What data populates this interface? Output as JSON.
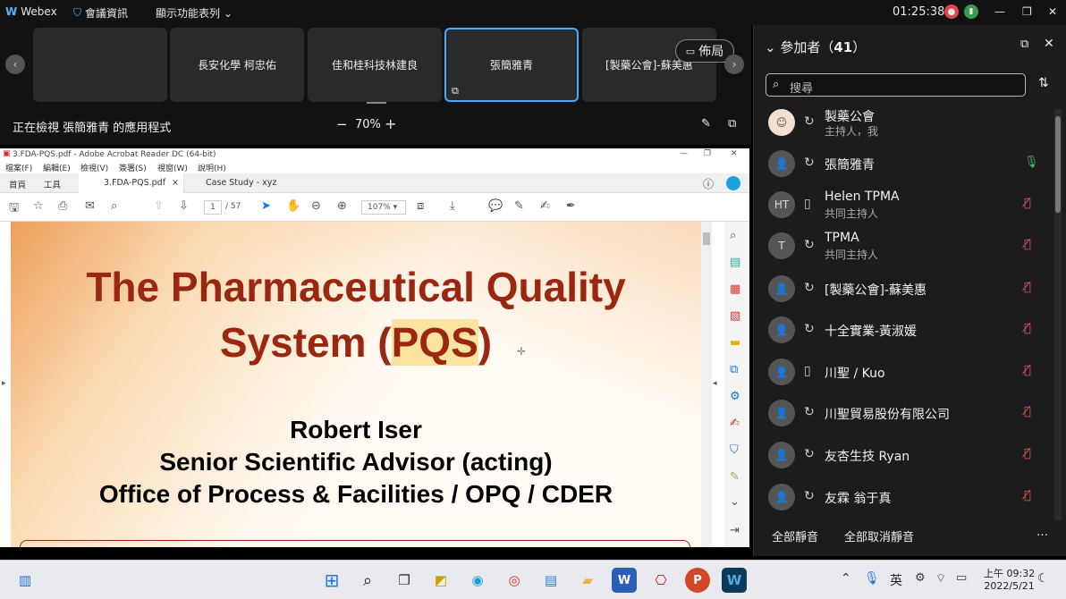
{
  "topbar": {
    "app": "Webex",
    "meeting_info": "會議資訊",
    "display_menu": "顯示功能表列",
    "time": "01:25:38"
  },
  "tiles": [
    "",
    "長安化學 柯忠佑",
    "佳和桂科技林建良",
    "張簡雅青",
    "[製藥公會]-蘇美惠"
  ],
  "layout_label": "佈局",
  "share": {
    "viewing": "正在檢視 張簡雅青 的應用程式",
    "zoom": "70%"
  },
  "pdf": {
    "title": "3.FDA-PQS.pdf - Adobe Acrobat Reader DC (64-bit)",
    "menu": [
      "檔案(F)",
      "編輯(E)",
      "檢視(V)",
      "簽署(S)",
      "視窗(W)",
      "說明(H)"
    ],
    "tabs": [
      "首頁",
      "工具",
      "3.FDA-PQS.pdf",
      "Case Study - xyz"
    ],
    "page": "1",
    "pages": "/ 57",
    "zoom": "107%",
    "slide": {
      "title1": "The Pharmaceutical Quality",
      "title2a": "System (",
      "title2b": "PQS",
      "title2c": ")",
      "author": "Robert Iser",
      "role": "Senior Scientific Advisor (acting)",
      "office": "Office of Process & Facilities / OPQ / CDER"
    }
  },
  "panel": {
    "title": "參加者（",
    "count": "41",
    "title_end": "）",
    "search_placeholder": "搜尋",
    "participants": [
      {
        "name": "製藥公會",
        "role": "主持人，我",
        "initials": ""
      },
      {
        "name": "張簡雅青",
        "role": "",
        "initials": ""
      },
      {
        "name": "Helen TPMA",
        "role": "共同主持人",
        "initials": "HT"
      },
      {
        "name": "TPMA",
        "role": "共同主持人",
        "initials": "T"
      },
      {
        "name": "[製藥公會]-蘇美惠",
        "role": "",
        "initials": ""
      },
      {
        "name": "十全實業-黃淑媛",
        "role": "",
        "initials": ""
      },
      {
        "name": "川聖 / Kuo",
        "role": "",
        "initials": ""
      },
      {
        "name": "川聖貿易股份有限公司",
        "role": "",
        "initials": ""
      },
      {
        "name": "友杏生技 Ryan",
        "role": "",
        "initials": ""
      },
      {
        "name": "友霖 翁于真",
        "role": "",
        "initials": ""
      }
    ],
    "mute_all": "全部靜音",
    "unmute_all": "全部取消靜音"
  },
  "taskbar": {
    "ime": "英",
    "time": "上午 09:32",
    "date": "2022/5/21"
  },
  "colors": {
    "accent": "#4aa8ff",
    "slide_title": "#9a2710",
    "muted": "#e05a5a",
    "unmuted": "#3fbf6a"
  }
}
